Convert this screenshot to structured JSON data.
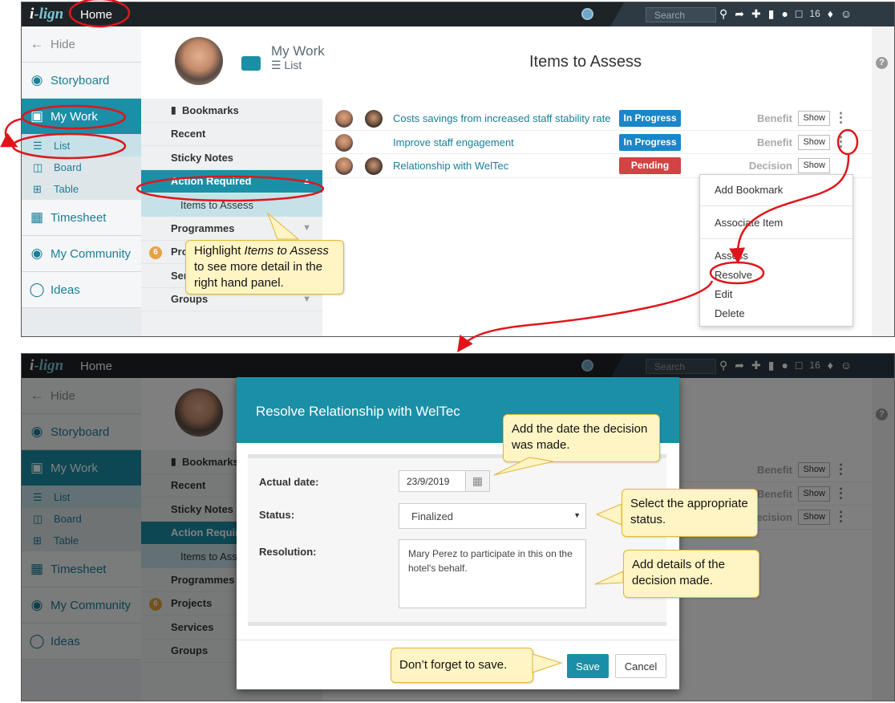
{
  "app": {
    "logo_i": "i",
    "logo_rest": "-lign",
    "home": "Home",
    "search_placeholder": "Search",
    "notification_count": "16"
  },
  "sidebar": {
    "hide": "Hide",
    "items": [
      {
        "label": "Storyboard"
      },
      {
        "label": "My Work"
      },
      {
        "label": "Timesheet"
      },
      {
        "label": "My Community"
      },
      {
        "label": "Ideas"
      }
    ],
    "subitems": [
      {
        "label": "List"
      },
      {
        "label": "Board"
      },
      {
        "label": "Table"
      }
    ]
  },
  "header": {
    "section": "My Work",
    "view": "List",
    "page_title": "Items to Assess"
  },
  "panel": {
    "bookmarks": "Bookmarks",
    "recent": "Recent",
    "sticky_notes": "Sticky Notes",
    "action_required": "Action Required",
    "items_to_assess": "Items to Assess",
    "programmes": "Programmes",
    "projects": "Projects",
    "projects_badge": "6",
    "services": "Services",
    "groups": "Groups"
  },
  "rows": [
    {
      "title": "Costs savings from increased staff stability rate",
      "status": "In Progress",
      "type": "Benefit",
      "action": "Show"
    },
    {
      "title": "Improve staff engagement",
      "status": "In Progress",
      "type": "Benefit",
      "action": "Show"
    },
    {
      "title": "Relationship with WelTec",
      "status": "Pending",
      "type": "Decision",
      "action": "Show"
    }
  ],
  "dropdown": [
    "Add Bookmark",
    "Associate Item",
    "Assess",
    "Resolve",
    "Edit",
    "Delete"
  ],
  "callouts": {
    "highlight_a": "Highlight ",
    "highlight_em": "Items to Assess",
    "highlight_b": "to see more detail in the right hand panel.",
    "date": "Add the date the decision was made.",
    "status": "Select the appropriate status.",
    "details": "Add details of the decision made.",
    "save": "Don’t forget to save."
  },
  "modal": {
    "title": "Resolve Relationship with WelTec",
    "actual_date_label": "Actual date:",
    "actual_date_value": "23/9/2019",
    "status_label": "Status:",
    "status_value": "Finalized",
    "resolution_label": "Resolution:",
    "resolution_value": "Mary Perez to participate in this on the hotel's behalf.",
    "save": "Save",
    "cancel": "Cancel"
  },
  "colors": {
    "teal": "#1b8fa6",
    "in_progress": "#1b86c8",
    "pending": "#d24343",
    "callout": "#fff4c4",
    "annotation_red": "#e0151b"
  }
}
